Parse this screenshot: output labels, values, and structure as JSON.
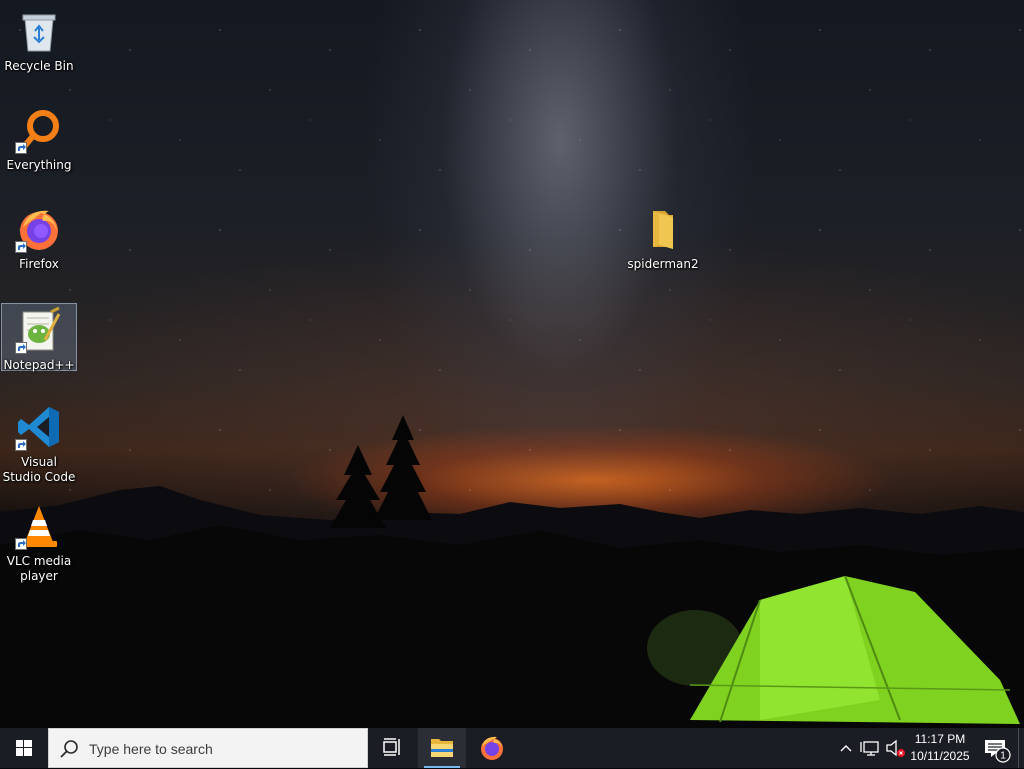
{
  "desktop": {
    "icons": [
      {
        "label": "Recycle Bin",
        "icon": "recycle-bin-icon"
      },
      {
        "label": "Everything",
        "icon": "everything-search-icon"
      },
      {
        "label": "Firefox",
        "icon": "firefox-icon"
      },
      {
        "label": "Notepad++",
        "icon": "notepad-plus-plus-icon"
      },
      {
        "label": "Visual Studio Code",
        "icon": "vscode-icon"
      },
      {
        "label": "VLC media player",
        "icon": "vlc-icon"
      }
    ],
    "folder": {
      "label": "spiderman2",
      "icon": "folder-icon"
    },
    "selected_icon": "Notepad++"
  },
  "taskbar": {
    "search_placeholder": "Type here to search",
    "pinned": [
      {
        "name": "File Explorer",
        "icon": "file-explorer-icon",
        "active": true
      },
      {
        "name": "Firefox",
        "icon": "firefox-icon",
        "active": false
      }
    ],
    "tray": {
      "time": "11:17 PM",
      "date": "10/11/2025",
      "notification_count": "1"
    }
  },
  "colors": {
    "taskbar_bg": "#1a1d24",
    "accent": "#76b9ed",
    "folder_yellow": "#f0c550",
    "tent_green": "#8ee02a"
  }
}
